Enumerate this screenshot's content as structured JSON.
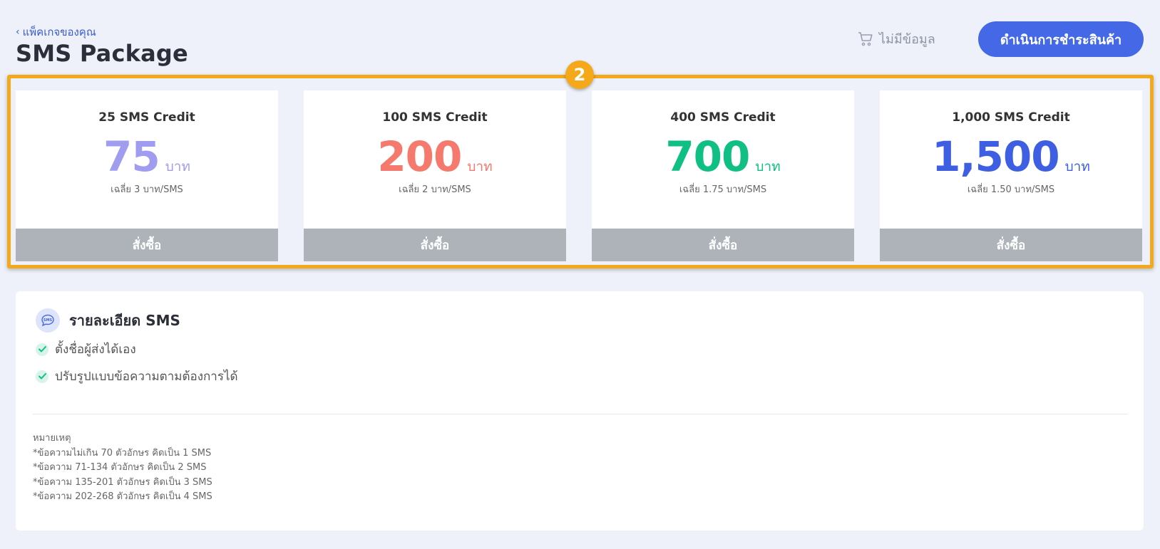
{
  "header": {
    "back_label": "แพ็คเกจของคุณ",
    "title": "SMS Package",
    "cart_label": "ไม่มีข้อมูล",
    "checkout_label": "ดำเนินการชำระสินค้า"
  },
  "annotation": {
    "badge": "2",
    "color": "#f2a91b"
  },
  "packages": [
    {
      "title": "25 SMS Credit",
      "price": "75",
      "unit": "บาท",
      "avg": "เฉลี่ย 3 บาท/SMS",
      "order_label": "สั่งซื้อ",
      "color": "#a09cf0"
    },
    {
      "title": "100 SMS Credit",
      "price": "200",
      "unit": "บาท",
      "avg": "เฉลี่ย 2 บาท/SMS",
      "order_label": "สั่งซื้อ",
      "color": "#f5796c"
    },
    {
      "title": "400 SMS Credit",
      "price": "700",
      "unit": "บาท",
      "avg": "เฉลี่ย 1.75 บาท/SMS",
      "order_label": "สั่งซื้อ",
      "color": "#0fbf83"
    },
    {
      "title": "1,000 SMS Credit",
      "price": "1,500",
      "unit": "บาท",
      "avg": "เฉลี่ย 1.50 บาท/SMS",
      "order_label": "สั่งซื้อ",
      "color": "#3f5fe3"
    }
  ],
  "details": {
    "title": "รายละเอียด SMS",
    "icon_text": "SMS",
    "features": [
      "ตั้งชื่อผู้ส่งได้เอง",
      "ปรับรูปแบบข้อความตามต้องการได้"
    ],
    "notes_title": "หมายเหตุ",
    "notes": [
      "*ข้อความไม่เกิน 70 ตัวอักษร คิดเป็น 1 SMS",
      "*ข้อความ 71-134 ตัวอักษร คิดเป็น 2 SMS",
      "*ข้อความ 135-201 ตัวอักษร คิดเป็น 3 SMS",
      "*ข้อความ 202-268 ตัวอักษร คิดเป็น 4 SMS"
    ]
  },
  "colors": {
    "primary": "#4468e6",
    "order_button": "#adb3b9",
    "check": "#0fbf83"
  }
}
